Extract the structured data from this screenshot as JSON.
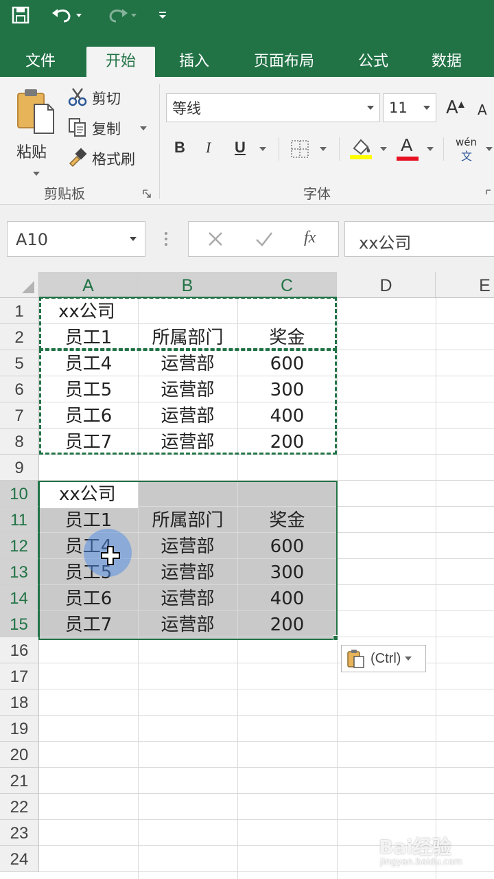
{
  "quick_access": {
    "save_icon": "save-icon",
    "undo_icon": "undo-icon",
    "redo_icon": "redo-icon",
    "customize_icon": "customize-qat-icon"
  },
  "tabs": [
    {
      "label": "文件",
      "active": false
    },
    {
      "label": "开始",
      "active": true
    },
    {
      "label": "插入",
      "active": false
    },
    {
      "label": "页面布局",
      "active": false
    },
    {
      "label": "公式",
      "active": false
    },
    {
      "label": "数据",
      "active": false
    }
  ],
  "clipboard": {
    "paste_label": "粘贴",
    "cut_label": "剪切",
    "copy_label": "复制",
    "format_painter_label": "格式刷",
    "group_label": "剪贴板"
  },
  "font": {
    "family": "等线",
    "size": "11",
    "grow_label": "A",
    "shrink_label": "A",
    "bold_label": "B",
    "italic_label": "I",
    "underline_label": "U",
    "font_color_label": "A",
    "phonetic_label": "wén",
    "phonetic_sub": "文",
    "group_label": "字体",
    "fill_color": "#ffff00",
    "font_color": "#e81123"
  },
  "formula_bar": {
    "name_box": "A10",
    "fx_label": "fx",
    "content": "xx公司"
  },
  "sheet": {
    "columns": [
      "A",
      "B",
      "C",
      "D",
      "E"
    ],
    "rows": [
      {
        "label": "1",
        "cells": [
          "xx公司",
          "",
          ""
        ]
      },
      {
        "label": "2",
        "cells": [
          "员工1",
          "所属部门",
          "奖金"
        ]
      },
      {
        "label": "5",
        "cells": [
          "员工4",
          "运营部",
          "600"
        ]
      },
      {
        "label": "6",
        "cells": [
          "员工5",
          "运营部",
          "300"
        ]
      },
      {
        "label": "7",
        "cells": [
          "员工6",
          "运营部",
          "400"
        ]
      },
      {
        "label": "8",
        "cells": [
          "员工7",
          "运营部",
          "200"
        ]
      },
      {
        "label": "9",
        "cells": [
          "",
          "",
          ""
        ]
      },
      {
        "label": "10",
        "cells": [
          "xx公司",
          "",
          ""
        ]
      },
      {
        "label": "11",
        "cells": [
          "员工1",
          "所属部门",
          "奖金"
        ]
      },
      {
        "label": "12",
        "cells": [
          "员工4",
          "运营部",
          "600"
        ]
      },
      {
        "label": "13",
        "cells": [
          "员工5",
          "运营部",
          "300"
        ]
      },
      {
        "label": "14",
        "cells": [
          "员工6",
          "运营部",
          "400"
        ]
      },
      {
        "label": "15",
        "cells": [
          "员工7",
          "运营部",
          "200"
        ]
      },
      {
        "label": "16",
        "cells": [
          "",
          "",
          ""
        ]
      },
      {
        "label": "17",
        "cells": [
          "",
          "",
          ""
        ]
      },
      {
        "label": "18",
        "cells": [
          "",
          "",
          ""
        ]
      },
      {
        "label": "19",
        "cells": [
          "",
          "",
          ""
        ]
      },
      {
        "label": "20",
        "cells": [
          "",
          "",
          ""
        ]
      },
      {
        "label": "21",
        "cells": [
          "",
          "",
          ""
        ]
      },
      {
        "label": "22",
        "cells": [
          "",
          "",
          ""
        ]
      },
      {
        "label": "23",
        "cells": [
          "",
          "",
          ""
        ]
      },
      {
        "label": "24",
        "cells": [
          "",
          "",
          ""
        ]
      }
    ],
    "paste_options_label": "(Ctrl)",
    "accent_color": "#217346"
  },
  "watermark": {
    "main": "Bai经验",
    "sub": "jingyan.baidu.com"
  }
}
